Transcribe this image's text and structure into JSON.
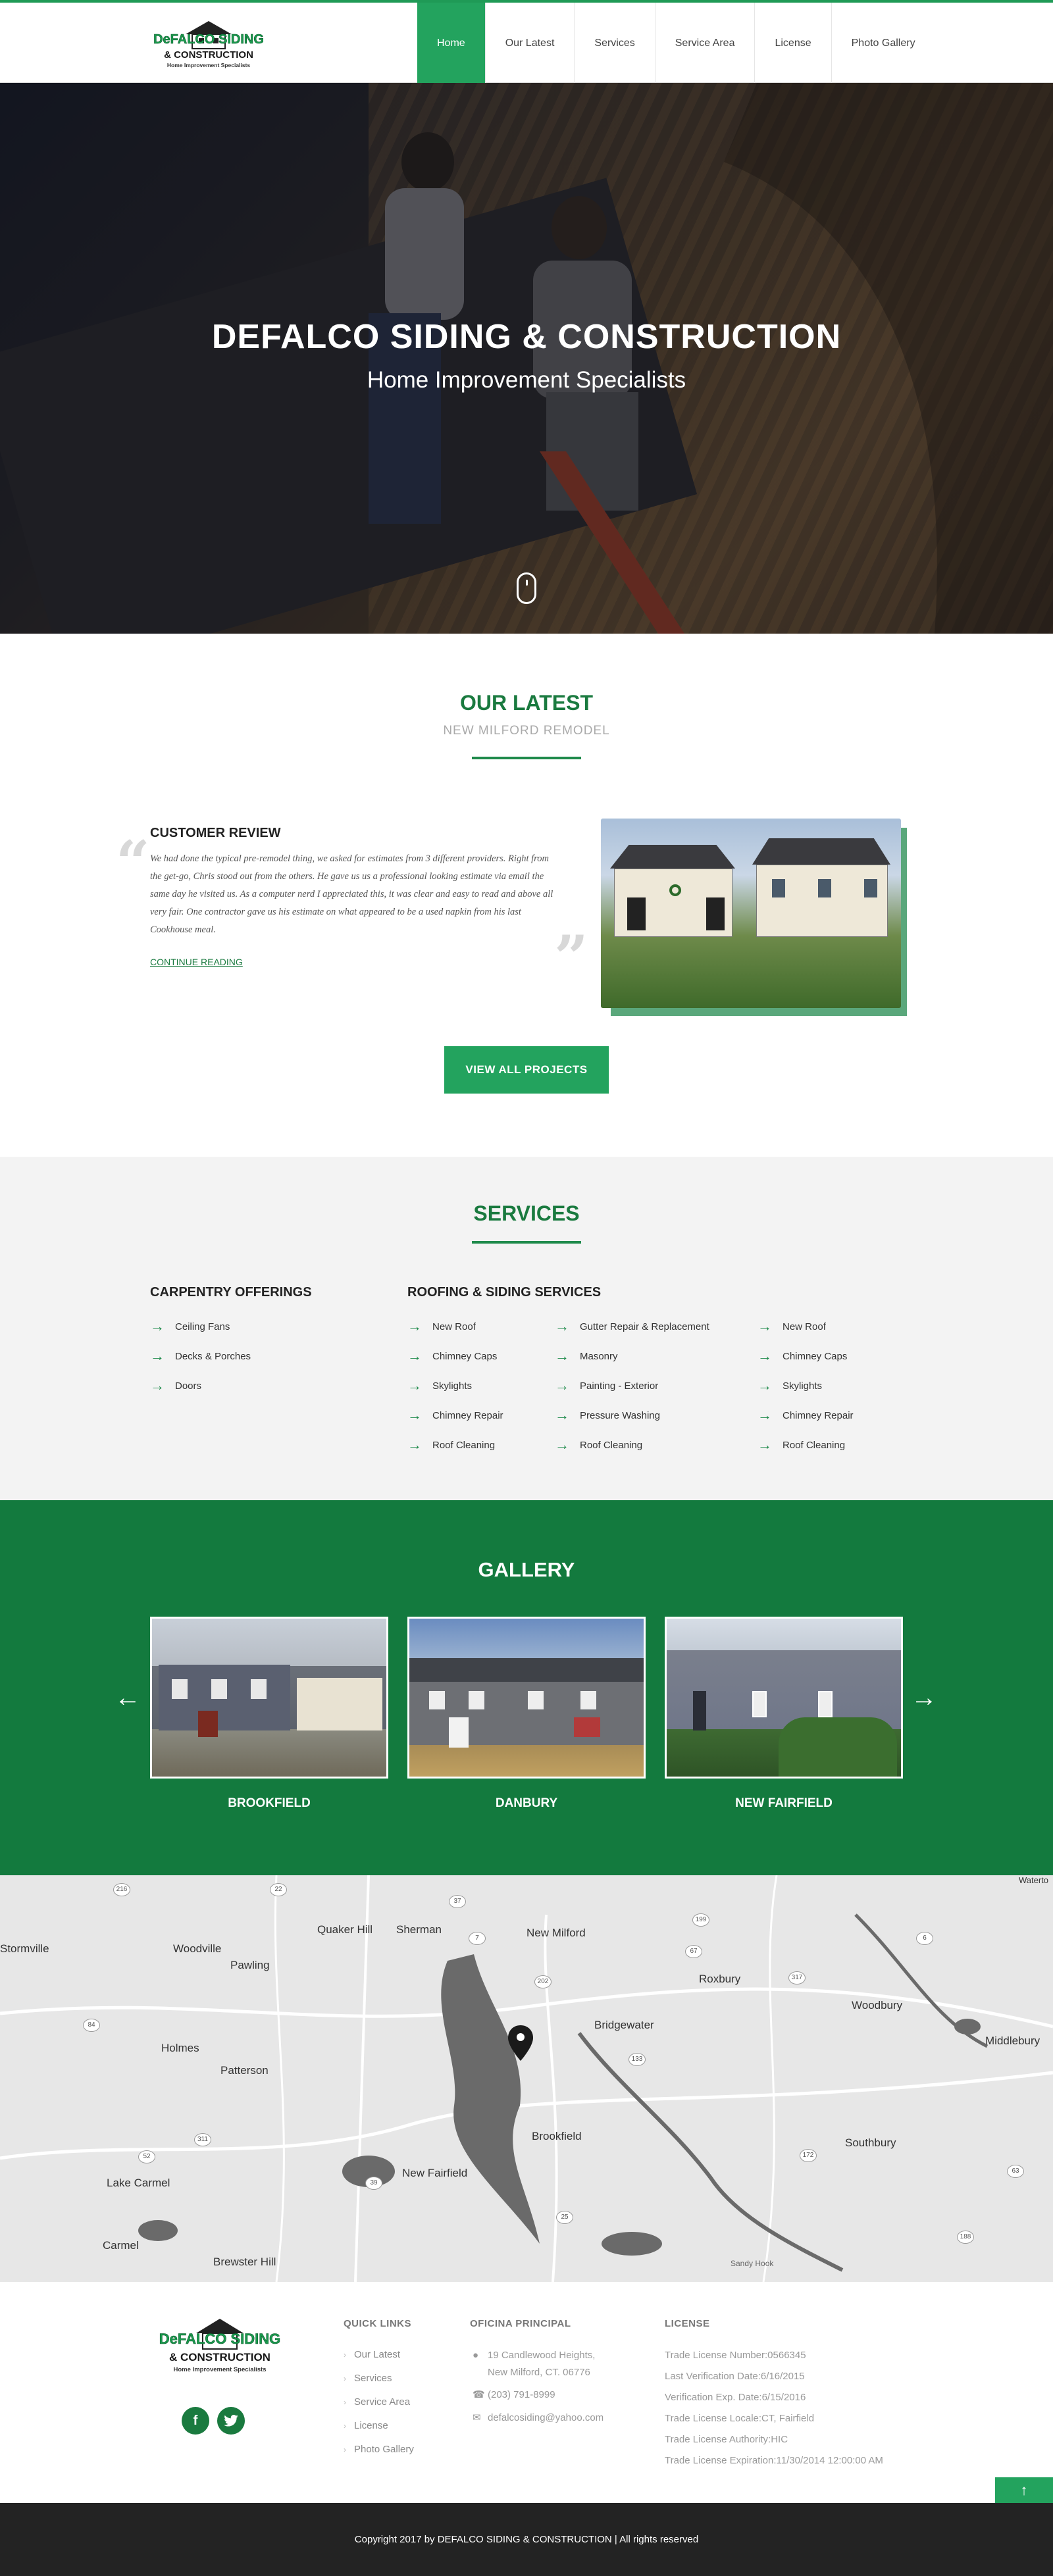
{
  "brand": {
    "logo_name": "DeFALCO SIDING",
    "logo_line2": "& CONSTRUCTION",
    "logo_tag": "Home Improvement Specialists",
    "accent": "#23a35e",
    "dark_green": "#137a3e"
  },
  "nav": {
    "items": [
      {
        "label": "Home",
        "active": true
      },
      {
        "label": "Our Latest"
      },
      {
        "label": "Services"
      },
      {
        "label": "Service Area"
      },
      {
        "label": "License"
      },
      {
        "label": "Photo Gallery"
      }
    ]
  },
  "hero": {
    "title": "DEFALCO SIDING & CONSTRUCTION",
    "subtitle": "Home Improvement Specialists"
  },
  "latest": {
    "title": "OUR LATEST",
    "subtitle": "NEW MILFORD REMODEL",
    "review_title": "CUSTOMER REVIEW",
    "review_text": "We had done the typical pre-remodel thing, we asked for estimates from 3 different providers. Right from the get-go, Chris stood out from the others. He gave us us a professional looking estimate via email the same day he visited us. As a computer nerd I appreciated this, it was clear and easy to read and above all very fair. One contractor gave us his estimate on what appeared to be a used napkin from his last Cookhouse meal.",
    "continue_label": "CONTINUE READING",
    "button_label": "VIEW ALL PROJECTS"
  },
  "services": {
    "title": "SERVICES",
    "carpentry_heading": "CARPENTRY OFFERINGS",
    "roofing_heading": "ROOFING & SIDING SERVICES",
    "carpentry": [
      "Ceiling Fans",
      "Decks & Porches",
      "Doors"
    ],
    "roofing_col1": [
      "New Roof",
      "Chimney Caps",
      "Skylights",
      "Chimney Repair",
      "Roof Cleaning"
    ],
    "roofing_col2": [
      "Gutter Repair & Replacement",
      "Masonry",
      "Painting - Exterior",
      "Pressure Washing",
      "Roof Cleaning"
    ],
    "roofing_col3": [
      "New Roof",
      "Chimney Caps",
      "Skylights",
      "Chimney Repair",
      "Roof Cleaning"
    ]
  },
  "gallery": {
    "title": "GALLERY",
    "items": [
      {
        "caption": "BROOKFIELD"
      },
      {
        "caption": "DANBURY"
      },
      {
        "caption": "NEW FAIRFIELD"
      }
    ]
  },
  "map": {
    "towns": [
      "Quaker Hill",
      "Sherman",
      "New Milford",
      "Woodville",
      "Pawling",
      "Stormville",
      "Roxbury",
      "Bridgewater",
      "Woodbury",
      "Middlebury",
      "Holmes",
      "Patterson",
      "Brookfield",
      "New Fairfield",
      "Southbury",
      "Lake Carmel",
      "Carmel",
      "Brewster Hill",
      "Sandy Hook",
      "Waterto"
    ],
    "routes": [
      "216",
      "22",
      "37",
      "7",
      "199",
      "67",
      "6",
      "84",
      "202",
      "317",
      "133",
      "311",
      "52",
      "39",
      "172",
      "188",
      "25",
      "63"
    ]
  },
  "footer": {
    "quick_links_heading": "QUICK LINKS",
    "quick_links": [
      "Our Latest",
      "Services",
      "Service Area",
      "License",
      "Photo Gallery"
    ],
    "office_heading": "OFICINA PRINCIPAL",
    "address_line1": "19 Candlewood Heights,",
    "address_line2": "New Milford, CT. 06776",
    "phone": "(203) 791-8999",
    "email": "defalcosiding@yahoo.com",
    "license_heading": "LICENSE",
    "license_lines": [
      "Trade License Number:0566345",
      "Last Verification Date:6/16/2015",
      "Verification Exp. Date:6/15/2016",
      "Trade License Locale:CT, Fairfield",
      "Trade License Authority:HIC",
      "Trade License Expiration:11/30/2014 12:00:00 AM"
    ],
    "copyright": "Copyright 2017 by DEFALCO SIDING & CONSTRUCTION | All rights reserved"
  }
}
